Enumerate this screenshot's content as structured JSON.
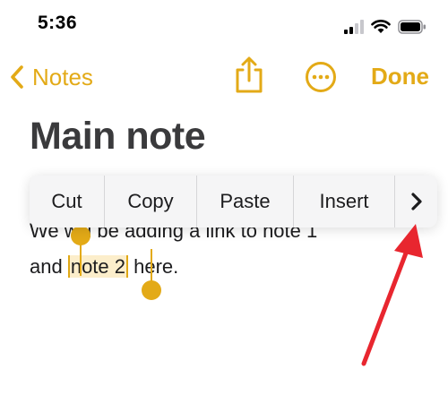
{
  "status_bar": {
    "time": "5:36"
  },
  "nav": {
    "back_label": "Notes",
    "done_label": "Done"
  },
  "note": {
    "title": "Main note",
    "line1": "We will be adding a link to note 1",
    "line2_before": "and ",
    "line2_selected": "note 2",
    "line2_after": " here."
  },
  "edit_menu": {
    "items": [
      {
        "label": "Cut"
      },
      {
        "label": "Copy"
      },
      {
        "label": "Paste"
      },
      {
        "label": "Insert"
      }
    ],
    "more_glyph": "›"
  },
  "colors": {
    "accent": "#e3aa17",
    "selection": "#f7d177",
    "annotation_arrow": "#e8262f"
  },
  "icons": {
    "back": "chevron-left-icon",
    "share": "share-icon",
    "more": "ellipsis-circle-icon",
    "signal": "cellular-signal-icon",
    "wifi": "wifi-icon",
    "battery": "battery-icon",
    "menu_next": "chevron-right-icon"
  }
}
